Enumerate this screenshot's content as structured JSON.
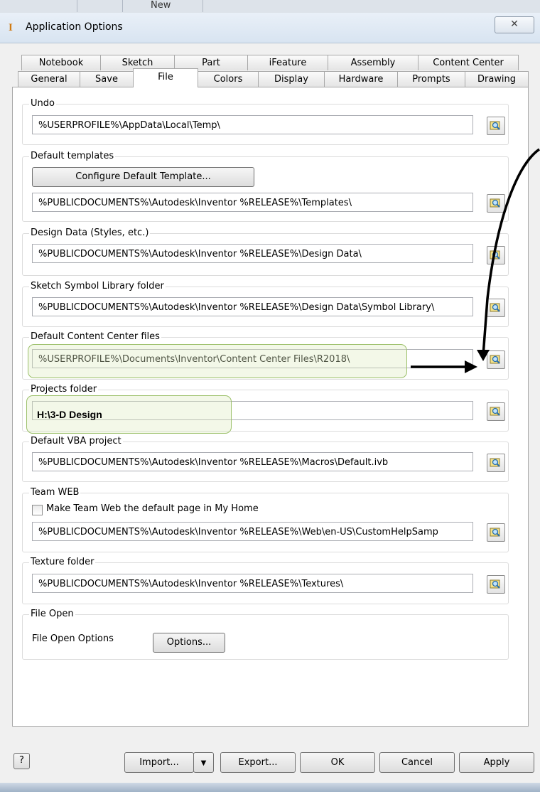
{
  "background_tab": "New",
  "window": {
    "title": "Application Options",
    "close_glyph": "✕"
  },
  "tabs_row1": [
    "Notebook",
    "Sketch",
    "Part",
    "iFeature",
    "Assembly",
    "Content Center"
  ],
  "tabs_row2": [
    "General",
    "Save",
    "File",
    "Colors",
    "Display",
    "Hardware",
    "Prompts",
    "Drawing"
  ],
  "active_tab": "File",
  "groups": {
    "undo": {
      "label": "Undo",
      "path": "%USERPROFILE%\\AppData\\Local\\Temp\\"
    },
    "templates": {
      "label": "Default templates",
      "button": "Configure Default Template...",
      "path": "%PUBLICDOCUMENTS%\\Autodesk\\Inventor %RELEASE%\\Templates\\"
    },
    "design_data": {
      "label": "Design Data (Styles, etc.)",
      "path": "%PUBLICDOCUMENTS%\\Autodesk\\Inventor %RELEASE%\\Design Data\\"
    },
    "symbol_library": {
      "label": "Sketch Symbol Library folder",
      "path": "%PUBLICDOCUMENTS%\\Autodesk\\Inventor %RELEASE%\\Design Data\\Symbol Library\\"
    },
    "content_center": {
      "label": "Default Content Center files",
      "path": "%USERPROFILE%\\Documents\\Inventor\\Content Center Files\\R2018\\"
    },
    "projects": {
      "label": "Projects folder",
      "path": "",
      "annotation": "H:\\3-D Design"
    },
    "vba": {
      "label": "Default VBA project",
      "path": "%PUBLICDOCUMENTS%\\Autodesk\\Inventor %RELEASE%\\Macros\\Default.ivb"
    },
    "team_web": {
      "label": "Team WEB",
      "checkbox_label": "Make Team Web the default page in My Home",
      "checked": false,
      "path": "%PUBLICDOCUMENTS%\\Autodesk\\Inventor %RELEASE%\\Web\\en-US\\CustomHelpSamp"
    },
    "texture": {
      "label": "Texture folder",
      "path": "%PUBLICDOCUMENTS%\\Autodesk\\Inventor %RELEASE%\\Textures\\"
    },
    "file_open": {
      "label": "File Open",
      "text": "File Open Options",
      "button": "Options..."
    }
  },
  "footer": {
    "help_glyph": "?",
    "import": "Import...",
    "export": "Export...",
    "ok": "OK",
    "cancel": "Cancel",
    "apply": "Apply"
  },
  "colors": {
    "highlight": "#9cc06a",
    "annotation_arrow": "#000000"
  }
}
